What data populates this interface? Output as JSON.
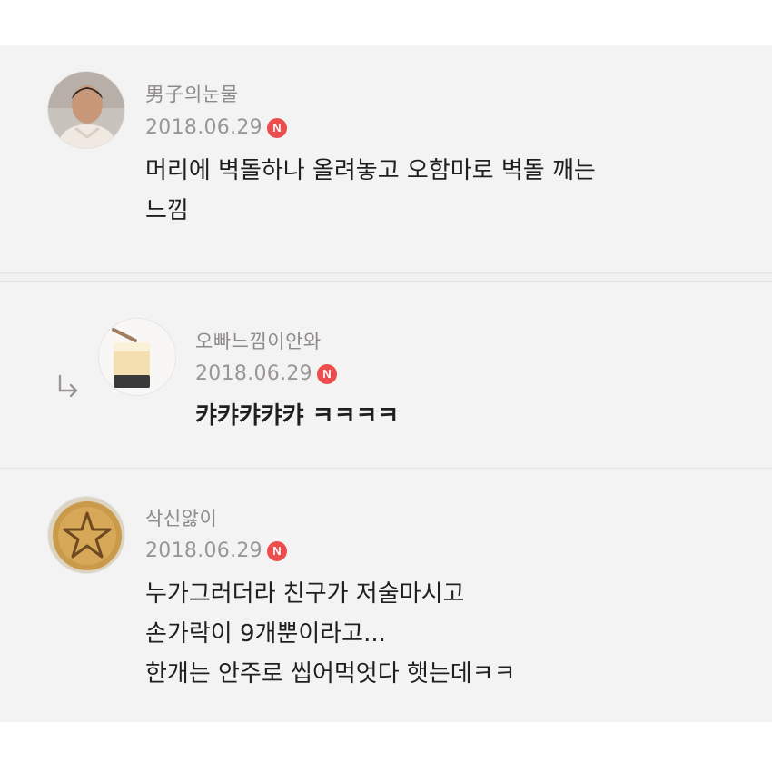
{
  "comments": [
    {
      "nickname": "男子의눈물",
      "date": "2018.06.29",
      "badge": "N",
      "lines": [
        "머리에 벽돌하나 올려놓고 오함마로 벽돌 깨는",
        "느낌"
      ]
    },
    {
      "nickname": "오빠느낌이안와",
      "date": "2018.06.29",
      "badge": "N",
      "is_reply": true,
      "lines": [
        "캬캬캬캬캬 ㅋㅋㅋㅋ"
      ]
    },
    {
      "nickname": "삭신앓이",
      "date": "2018.06.29",
      "badge": "N",
      "lines": [
        "누가그러더라 친구가 저술마시고",
        "손가락이 9개뿐이라고...",
        "한개는 안주로 씹어먹엇다 햇는데ㅋㅋ"
      ]
    }
  ],
  "icons": {
    "reply": "reply-arrow-icon",
    "new_badge": "new-badge-icon"
  },
  "colors": {
    "background": "#f4f3f3",
    "badge": "#ec4d4d",
    "nickname": "#8e8a8a",
    "text": "#1f1f1f"
  }
}
